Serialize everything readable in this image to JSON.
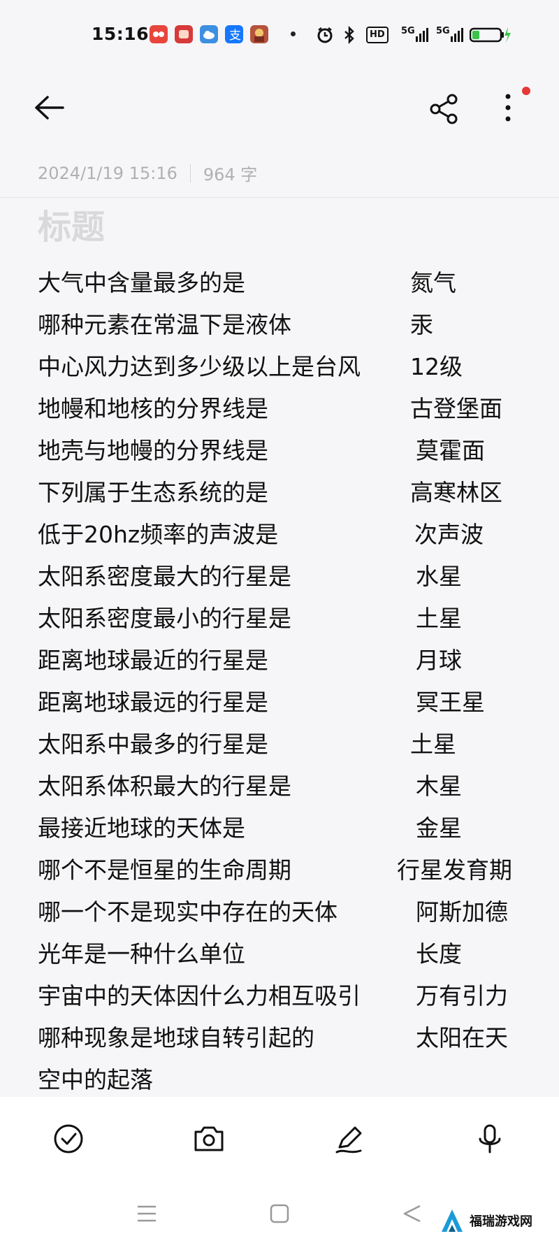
{
  "status_bar": {
    "time": "15:16",
    "hd_label": "HD",
    "network_1": "5G",
    "network_2": "5G",
    "battery_level": 0.25
  },
  "toolbar": {
    "back_icon": "arrow-left",
    "share_icon": "share",
    "more_icon": "more-vertical"
  },
  "note": {
    "timestamp": "2024/1/19 15:16",
    "word_count": "964 字",
    "title_placeholder": "标题",
    "items": [
      {
        "q": "大气中含量最多的是",
        "a": "氮气"
      },
      {
        "q": "哪种元素在常温下是液体",
        "a": "汞"
      },
      {
        "q": "中心风力达到多少级以上是台风",
        "a": "12级"
      },
      {
        "q": "地幔和地核的分界线是",
        "a": "古登堡面"
      },
      {
        "q": "地壳与地幔的分界线是",
        "a": "莫霍面"
      },
      {
        "q": "下列属于生态系统的是",
        "a": "高寒林区"
      },
      {
        "q": "低于20hz频率的声波是",
        "a": "次声波"
      },
      {
        "q": "太阳系密度最大的行星是",
        "a": "水星"
      },
      {
        "q": "太阳系密度最小的行星是",
        "a": "土星"
      },
      {
        "q": "距离地球最近的行星是",
        "a": "月球"
      },
      {
        "q": "距离地球最远的行星是",
        "a": "冥王星"
      },
      {
        "q": "太阳系中最多的行星是",
        "a": "土星"
      },
      {
        "q": "太阳系体积最大的行星是",
        "a": "木星"
      },
      {
        "q": "最接近地球的天体是",
        "a": "金星"
      },
      {
        "q": "哪个不是恒星的生命周期",
        "a": "行星发育期"
      },
      {
        "q": "哪一个不是现实中存在的天体",
        "a": "阿斯加德"
      },
      {
        "q": "光年是一种什么单位",
        "a": "长度"
      },
      {
        "q": "宇宙中的天体因什么力相互吸引",
        "a": "万有引力"
      },
      {
        "q": "哪种现象是地球自转引起的",
        "a": "太阳在天"
      },
      {
        "q": "空中的起落",
        "a": ""
      }
    ]
  },
  "bottom_tools": [
    "check-circle-icon",
    "camera-icon",
    "pen-icon",
    "microphone-icon"
  ],
  "nav": [
    "menu-icon",
    "home-square-icon",
    "back-triangle-icon"
  ],
  "watermark": {
    "text": "福瑞游戏网"
  }
}
